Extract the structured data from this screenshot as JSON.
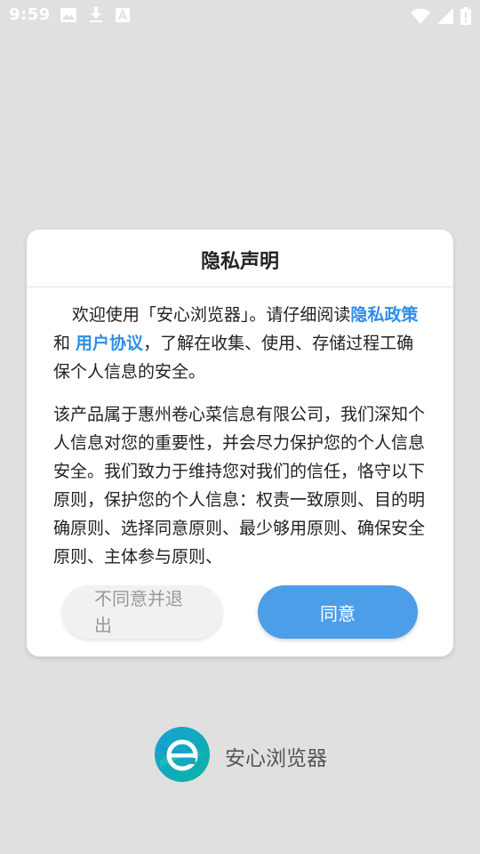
{
  "status_bar": {
    "time": "9:59",
    "left_icons": [
      "image-icon",
      "download-icon",
      "font-icon"
    ],
    "right_icons": [
      "wifi-icon",
      "signal-icon",
      "battery-icon"
    ]
  },
  "dialog": {
    "title": "隐私声明",
    "para1_prefix": "欢迎使用「安心浏览器」。请仔细阅读",
    "privacy_link": "隐私政策",
    "and_text": " 和 ",
    "agreement_link": "用户协议",
    "para1_suffix": "，了解在收集、使用、存储过程工确保个人信息的安全。",
    "para2": "该产品属于惠州卷心菜信息有限公司，我们深知个人信息对您的重要性，并会尽力保护您的个人信息安全。我们致力于维持您对我们的信任，恪守以下原则，保护您的个人信息：权责一致原则、目的明确原则、选择同意原则、最少够用原则、确保安全原则、主体参与原则、",
    "decline_label": "不同意并退出",
    "agree_label": "同意"
  },
  "brand": {
    "app_name": "安心浏览器",
    "logo_letter": "e"
  },
  "colors": {
    "background": "#e0e0e0",
    "link": "#2f8ee8",
    "agree_button": "#4d9ee8",
    "decline_button": "#f1f1f1"
  }
}
